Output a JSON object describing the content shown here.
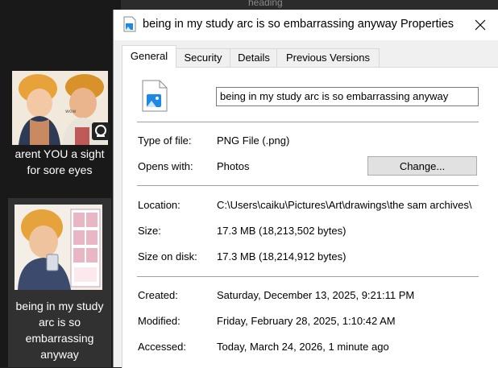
{
  "background": {
    "partial_text": "heading"
  },
  "explorer": {
    "items": [
      {
        "label": "arent YOU a sight for sore eyes",
        "badge_icon": "clip-studio-icon"
      },
      {
        "label": "being in my study arc is so embarrassing anyway"
      }
    ]
  },
  "window": {
    "title": "being in my study arc is so embarrassing anyway Properties",
    "close_icon": "close-icon",
    "tabs": [
      "General",
      "Security",
      "Details",
      "Previous Versions"
    ],
    "active_tab": "General"
  },
  "general": {
    "file_name": "being in my study arc is so embarrassing anyway",
    "type_label": "Type of file:",
    "type_value": "PNG File (.png)",
    "opens_label": "Opens with:",
    "opens_value": "Photos",
    "change_button": "Change...",
    "location_label": "Location:",
    "location_value": "C:\\Users\\caiku\\Pictures\\Art\\drawings\\the sam archives\\",
    "size_label": "Size:",
    "size_value": "17.3 MB (18,213,502 bytes)",
    "size_disk_label": "Size on disk:",
    "size_disk_value": "17.3 MB (18,214,912 bytes)",
    "created_label": "Created:",
    "created_value": "Saturday, December 13, 2025, 9:21:11 PM",
    "modified_label": "Modified:",
    "modified_value": "Friday, February 28, 2025, 1:10:42 AM",
    "accessed_label": "Accessed:",
    "accessed_value": "Today, March 24, 2026, 1 minute ago"
  },
  "colors": {
    "explorer_bg": "#191919",
    "selected_item_bg": "#313131",
    "dialog_bg": "#f0f0f0",
    "panel_bg": "#ffffff",
    "button_bg": "#e1e1e1",
    "photos_icon_blue": "#1e88e5"
  }
}
